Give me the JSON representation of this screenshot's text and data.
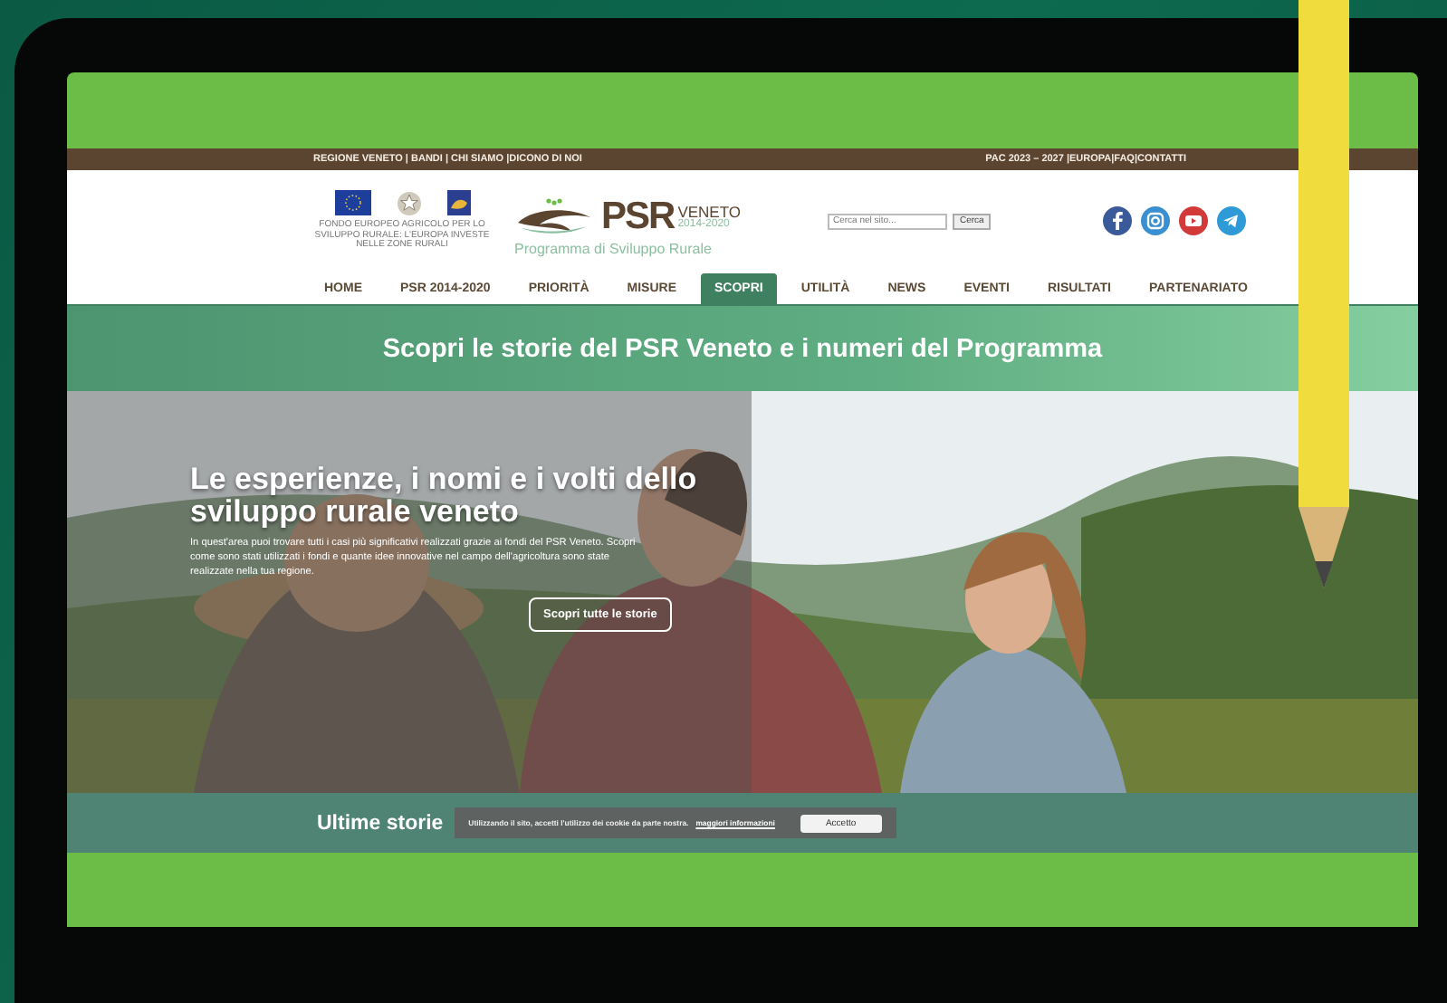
{
  "top_bar": {
    "left": "REGIONE VENETO | BANDI | CHI SIAMO |DICONO DI NOI",
    "right": "PAC 2023 – 2027 |EUROPA|FAQ|CONTATTI"
  },
  "header": {
    "eu_caption": "FONDO EUROPEO AGRICOLO PER LO SVILUPPO RURALE: L'EUROPA INVESTE NELLE ZONE RURALI",
    "logo": {
      "mark": "PSR",
      "region": "VENETO",
      "years": "2014-2020",
      "tagline": "Programma di Sviluppo Rurale"
    },
    "search": {
      "placeholder": "Cerca nel sito...",
      "button": "Cerca"
    }
  },
  "nav": [
    {
      "label": "HOME",
      "selected": false
    },
    {
      "label": "PSR 2014-2020",
      "selected": false
    },
    {
      "label": "PRIORITÀ",
      "selected": false
    },
    {
      "label": "MISURE",
      "selected": false
    },
    {
      "label": "SCOPRI",
      "selected": true
    },
    {
      "label": "UTILITÀ",
      "selected": false
    },
    {
      "label": "NEWS",
      "selected": false
    },
    {
      "label": "EVENTI",
      "selected": false
    },
    {
      "label": "RISULTATI",
      "selected": false
    },
    {
      "label": "PARTENARIATO",
      "selected": false
    }
  ],
  "banner": {
    "title": "Scopri le storie del PSR Veneto e i numeri del Programma"
  },
  "hero": {
    "title": "Le esperienze, i nomi e i volti dello sviluppo rurale veneto",
    "text": "In quest'area puoi trovare tutti i casi più significativi realizzati grazie ai fondi del PSR Veneto. Scopri come sono stati utilizzati i fondi e quante idee innovative nel campo dell'agricoltura sono state realizzate nella tua regione.",
    "button": "Scopri tutte le storie"
  },
  "section": {
    "title": "Ultime storie"
  },
  "cookie_bar": {
    "text": "Utilizzando il sito, accetti l'utilizzo dei cookie da parte nostra.",
    "link": "maggiori informazioni",
    "button": "Accetto"
  }
}
